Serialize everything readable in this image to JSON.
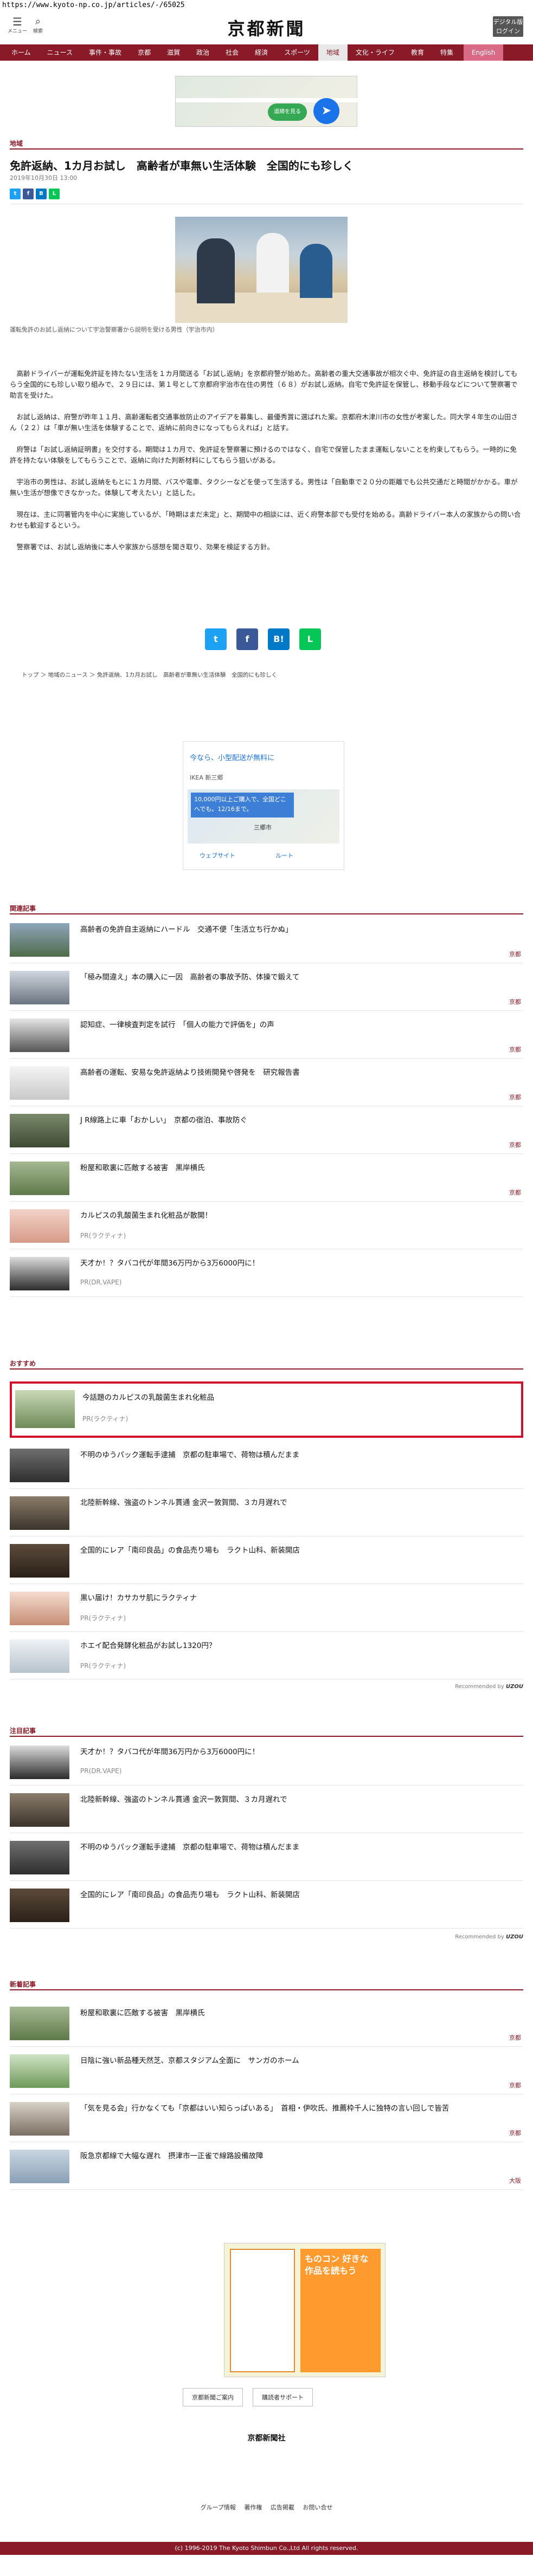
{
  "url": "https://www.kyoto-np.co.jp/articles/-/65025",
  "header": {
    "menu_label": "メニュー",
    "search_label": "検索",
    "logo": "京都新聞",
    "digital_label": "デジタル版ログイン"
  },
  "nav": [
    "ホーム",
    "ニュース",
    "事件・事故",
    "京都",
    "滋賀",
    "政治",
    "社会",
    "経済",
    "スポーツ",
    "地域",
    "文化・ライフ",
    "教育",
    "特集",
    "English"
  ],
  "nav_active": "地域",
  "ad_top_button": "道順を見る",
  "section": "地域",
  "article": {
    "title": "免許返納、1カ月お試し　高齢者が車無い生活体験　全国的にも珍しく",
    "date": "2019年10月30日 13:00",
    "caption": "運転免許のお試し返納について宇治警察署から説明を受ける男性（宇治市内）",
    "paragraphs": [
      "高齢ドライバーが運転免許証を持たない生活を１カ月間送る「お試し返納」を京都府警が始めた。高齢者の重大交通事故が相次ぐ中、免許証の自主返納を検討してもらう全国的にも珍しい取り組みで、２９日には、第１号として京都府宇治市在住の男性（６８）がお試し返納。自宅で免許証を保管し、移動手段などについて警察署で助言を受けた。",
      "お試し返納は、府警が昨年１１月、高齢運転者交通事故防止のアイデアを募集し、最優秀賞に選ばれた案。京都府木津川市の女性が考案した。同大学４年生の山田さん（２２）は「車が無い生活を体験することで、返納に前向きになってもらえれば」と話す。",
      "府警は「お試し返納証明書」を交付する。期間は１カ月で、免許証を警察署に預けるのではなく、自宅で保管したまま運転しないことを約束してもらう。一時的に免許を持たない体験をしてもらうことで、返納に向けた判断材料にしてもらう狙いがある。",
      "宇治市の男性は、お試し返納をもとに１カ月間、バスや電車、タクシーなどを使って生活する。男性は「自動車で２０分の距離でも公共交通だと時間がかかる。車が無い生活が想像できなかった。体験して考えたい」と話した。",
      "現在は、主に同署管内を中心に実施しているが、「時期はまだ未定」と、期間中の相談には、近く府警本部でも受付を始める。高齢ドライバー本人の家族からの問い合わせも歓迎するという。",
      "警察署では、お試し返納後に本人や家族から感想を聞き取り、効果を検証する方針。"
    ]
  },
  "breadcrumb": "トップ ＞ 地域のニュース ＞ 免許返納、1カ月お試し　高齢者が車無い生活体験　全国的にも珍しく",
  "ad_mid": {
    "title": "今なら、小型配送が無料に",
    "subtitle": "IKEA 新三郷",
    "bubble": "10,000円以上ご購入で、全国どこへでも。12/16まで。",
    "location": "三郷市",
    "website": "ウェブサイト",
    "route": "ルート"
  },
  "related": {
    "label": "関連記事",
    "items": [
      {
        "title": "高齢者の免許自主返納にハードル　交通不便「生活立ち行かぬ」",
        "cat": "京都"
      },
      {
        "title": "「極み間違え」本の購入に一因　高齢者の事故予防、体操で鍛えて",
        "cat": "京都"
      },
      {
        "title": "認知症、一律検査判定を試行　「個人の能力で評価を」の声",
        "cat": "京都"
      },
      {
        "title": "高齢者の運転、安易な免許返納より技術開発や啓発を　研究報告書",
        "cat": "京都"
      },
      {
        "title": "J R線路上に車「おかしい」　京都の宿泊、事故防ぐ",
        "cat": "京都"
      },
      {
        "title": "粉屋和歌裏に匹敵する被害　黒岸横氏",
        "cat": "京都"
      },
      {
        "title": "カルピスの乳酸菌生まれ化粧品が散開！",
        "pr": "PR(ラクティナ)"
      },
      {
        "title": "天才か！？タバコ代が年間36万円から3万6000円に！",
        "pr": "PR(DR.VAPE)"
      }
    ]
  },
  "recommended": {
    "label": "おすすめ",
    "highlight": {
      "title": "今話題のカルピスの乳酸菌生まれ化粧品",
      "pr": "PR(ラクティナ)"
    },
    "items": [
      {
        "title": "不明のゆうパック運転手逮捕　京都の駐車場で、荷物は積んだまま"
      },
      {
        "title": "北陸新幹線、強盗のトンネル貫通 金沢ー敦賀間、３カ月遅れで"
      },
      {
        "title": "全国的にレア「南印良品」の食品売り場も　ラクト山科、新装開店"
      },
      {
        "title": "黒い届け！カサカサ肌にラクティナ",
        "pr": "PR(ラクティナ)"
      },
      {
        "title": "ホエイ配合発酵化粧品がお試し1320円？",
        "pr": "PR(ラクティナ)"
      }
    ],
    "powered": "Recommended by",
    "brand": "UZOU"
  },
  "attention": {
    "label": "注目記事",
    "items": [
      {
        "title": "天才か！？タバコ代が年間36万円から3万6000円に！",
        "pr": "PR(DR.VAPE)"
      },
      {
        "title": "北陸新幹線、強盗のトンネル貫通 金沢ー敦賀間、３カ月遅れで"
      },
      {
        "title": "不明のゆうパック運転手逮捕　京都の駐車場で、荷物は積んだまま"
      },
      {
        "title": "全国的にレア「南印良品」の食品売り場も　ラクト山科、新装開店"
      }
    ],
    "powered": "Recommended by",
    "brand": "UZOU"
  },
  "latest": {
    "label": "新着記事",
    "items": [
      {
        "title": "粉屋和歌裏に匹敵する被害　黒岸横氏",
        "cat": "京都"
      },
      {
        "title": "日陰に強い新品種天然芝、京都スタジアム全面に　サンガのホーム",
        "cat": "京都"
      },
      {
        "title": "「気を見る会」行かなくても「京都はいい知らっぱいある」　首相・伊吹氏、推薦枠千人に独特の言い回しで皆苦",
        "cat": "京都"
      },
      {
        "title": "阪急京都線で大幅な遅れ　摂津市一正雀で線路設備故障",
        "cat": "大阪"
      }
    ]
  },
  "ad_bottom": "ものコン 好きな作品を読もう",
  "bottom_buttons": [
    "京都新聞ご案内",
    "購読者サポート"
  ],
  "footer": {
    "logo": "京都新聞社",
    "links": [
      "グループ情報",
      "著作権",
      "広告掲載",
      "お問い合せ"
    ],
    "copyright": "(c) 1996-2019 The Kyoto Shimbun Co.,Ltd All rights reserved."
  },
  "colors": {
    "brand": "#8b1a28",
    "highlight": "#d0102a"
  }
}
